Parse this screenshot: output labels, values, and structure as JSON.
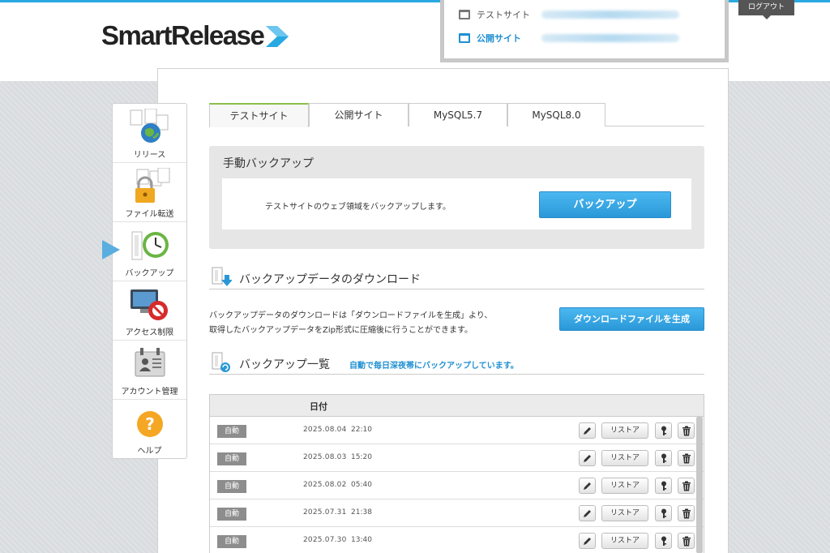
{
  "brand": {
    "name": "SmartRelease",
    "accent": "#29a9e1"
  },
  "header": {
    "sites": [
      {
        "label": "テストサイト",
        "icon": "window-icon"
      },
      {
        "label": "公開サイト",
        "icon": "window-icon"
      }
    ],
    "logout_label": "ログアウト"
  },
  "sidebar": {
    "items": [
      {
        "label": "リリース",
        "icon": "globe-release-icon"
      },
      {
        "label": "ファイル転送",
        "icon": "lock-files-icon"
      },
      {
        "label": "バックアップ",
        "icon": "clock-backup-icon",
        "active": true
      },
      {
        "label": "アクセス制限",
        "icon": "monitor-blocked-icon"
      },
      {
        "label": "アカウント管理",
        "icon": "id-badge-icon"
      },
      {
        "label": "ヘルプ",
        "icon": "help-icon"
      }
    ]
  },
  "tabs": [
    {
      "label": "テストサイト",
      "active": true
    },
    {
      "label": "公開サイト"
    },
    {
      "label": "MySQL5.7"
    },
    {
      "label": "MySQL8.0"
    }
  ],
  "manual": {
    "title": "手動バックアップ",
    "description": "テストサイトのウェブ領域をバックアップします。",
    "button": "バックアップ"
  },
  "download": {
    "title": "バックアップデータのダウンロード",
    "description_line1": "バックアップデータのダウンロードは「ダウンロードファイルを生成」より、",
    "description_line2": "取得したバックアップデータをZip形式に圧縮後に行うことができます。",
    "button": "ダウンロードファイルを生成"
  },
  "list": {
    "title": "バックアップ一覧",
    "note": "自動で毎日深夜帯にバックアップしています。",
    "column_date": "日付",
    "restore_label": "リストア",
    "rows": [
      {
        "type": "自動",
        "date": "2025.08.04",
        "time": "22:10"
      },
      {
        "type": "自動",
        "date": "2025.08.03",
        "time": "15:20"
      },
      {
        "type": "自動",
        "date": "2025.08.02",
        "time": "05:40"
      },
      {
        "type": "自動",
        "date": "2025.07.31",
        "time": "21:38"
      },
      {
        "type": "自動",
        "date": "2025.07.30",
        "time": "13:40"
      }
    ]
  }
}
